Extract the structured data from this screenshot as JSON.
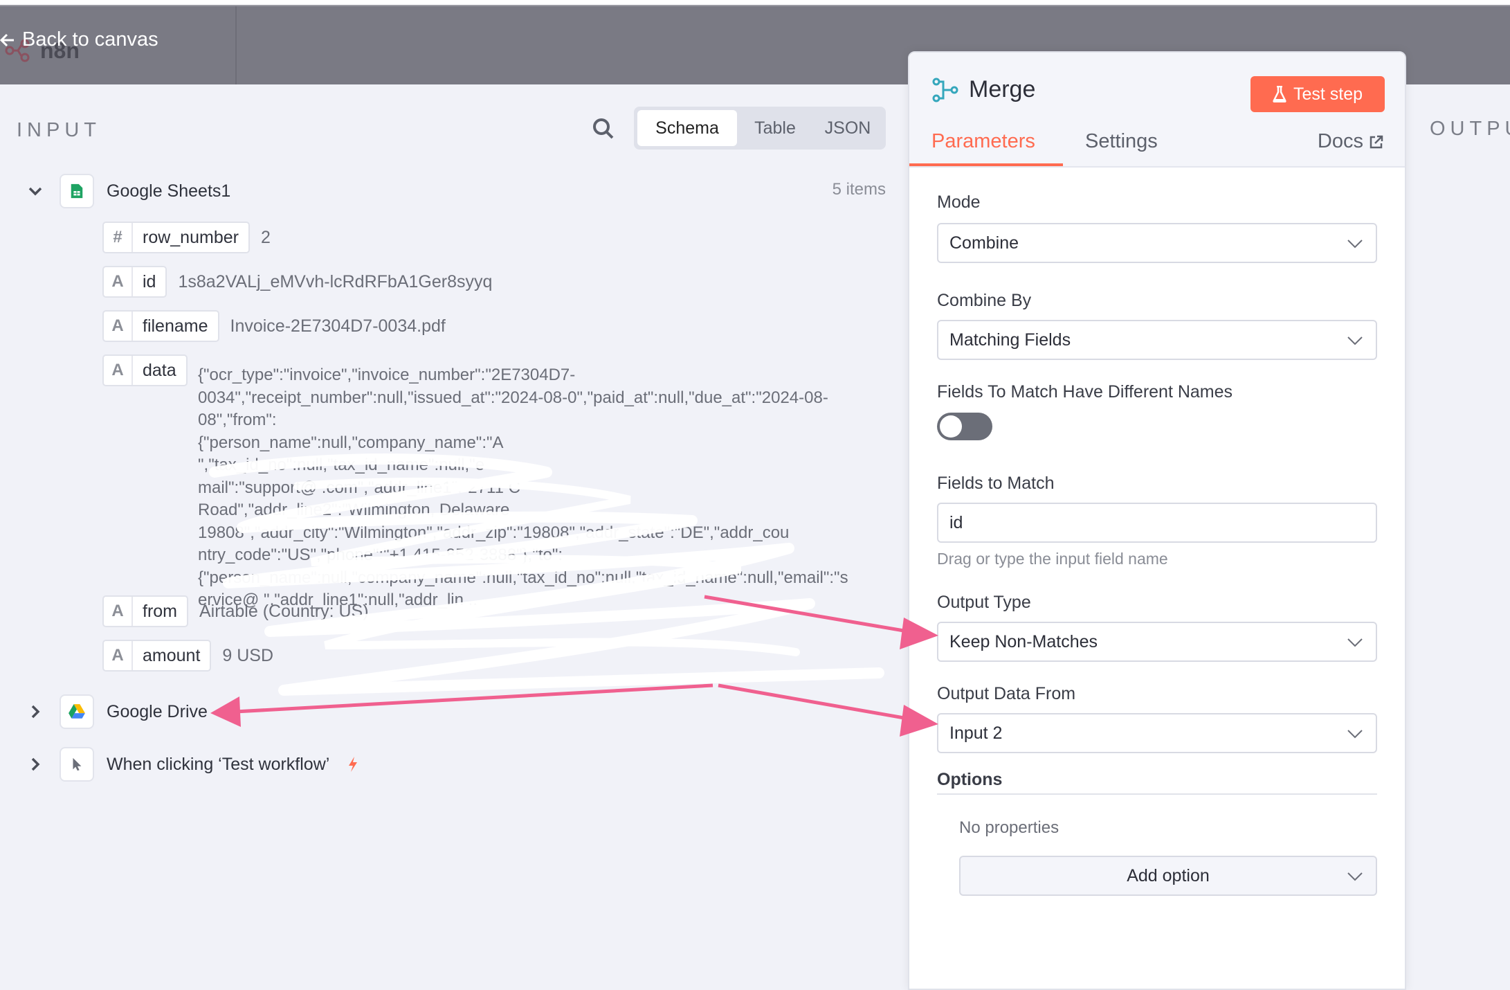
{
  "header": {
    "brand": "n8n",
    "back_label": "Back to canvas"
  },
  "input_panel": {
    "title": "INPUT",
    "view_tabs": [
      "Schema",
      "Table",
      "JSON"
    ],
    "active_view": "Schema",
    "nodes": [
      {
        "name": "Google Sheets1",
        "items": "5 items",
        "expanded": true,
        "fields": [
          {
            "type": "#",
            "key": "row_number",
            "value": "2"
          },
          {
            "type": "A",
            "key": "id",
            "value": "1s8a2VALj_eMVvh-lcRdRFbA1Ger8syyq"
          },
          {
            "type": "A",
            "key": "filename",
            "value": "Invoice-2E7304D7-0034.pdf"
          },
          {
            "type": "A",
            "key": "data",
            "value_lines": [
              "{\"ocr_type\":\"invoice\",\"invoice_number\":\"2E7304D7-",
              "0034\",\"receipt_number\":null,\"issued_at\":\"2024-08-0\",\"paid_at\":null,\"due_at\":\"2024-08-",
              "08\",\"from\":",
              "{\"person_name\":null,\"company_name\":\"A",
              "\",\"tax_id_no\":null,\"tax_id_name\":null,\"e",
              "mail\":\"support@          .com\",\"addr_line1\":\"2711 C",
              "Road\",\"addr_line2\":\"Wilmington, Delaware",
              "19808\",\"addr_city\":\"Wilmington\",\"addr_zip\":\"19808\",\"addr_state\":\"DE\",\"addr_cou",
              "ntry_code\":\"US\",\"phone\":\"+1 415-852-3888\"},\"to\":",
              "{\"person_name\":null,\"company_name\":null,\"tax_id_no\":null,\"tax_id_name\":null,\"email\":\"s",
              "ervice@          \",\"addr_line1\":null,\"addr_lin .."
            ]
          },
          {
            "type": "A",
            "key": "from",
            "value": "Airtable (Country: US)"
          },
          {
            "type": "A",
            "key": "amount",
            "value": "9 USD"
          }
        ]
      },
      {
        "name": "Google Drive",
        "expanded": false
      },
      {
        "name": "When clicking ‘Test workflow’",
        "expanded": false
      }
    ]
  },
  "merge_panel": {
    "title": "Merge",
    "test_button": "Test step",
    "tabs": [
      "Parameters",
      "Settings"
    ],
    "active_tab": "Parameters",
    "docs_label": "Docs",
    "mode": {
      "label": "Mode",
      "value": "Combine"
    },
    "combine_by": {
      "label": "Combine By",
      "value": "Matching Fields"
    },
    "different_names": {
      "label": "Fields To Match Have Different Names",
      "enabled": false
    },
    "fields_to_match": {
      "label": "Fields to Match",
      "value": "id",
      "hint": "Drag or type the input field name"
    },
    "output_type": {
      "label": "Output Type",
      "value": "Keep Non-Matches"
    },
    "output_data_from": {
      "label": "Output Data From",
      "value": "Input 2"
    },
    "options": {
      "title": "Options",
      "empty": "No properties",
      "add_label": "Add option"
    }
  },
  "output_panel": {
    "title": "OUTPUT"
  },
  "colors": {
    "accent": "#ff6b50",
    "annotation_arrow": "#f0608f",
    "topbar": "#7a7a84",
    "panel_bg": "#f1f2f8"
  },
  "icons": {
    "back": "arrow-left-icon",
    "search": "search-icon",
    "sheets": "google-sheets-icon",
    "drive": "google-drive-icon",
    "trigger": "cursor-pointer-icon",
    "merge": "merge-icon",
    "flask": "flask-icon",
    "external": "external-link-icon"
  }
}
